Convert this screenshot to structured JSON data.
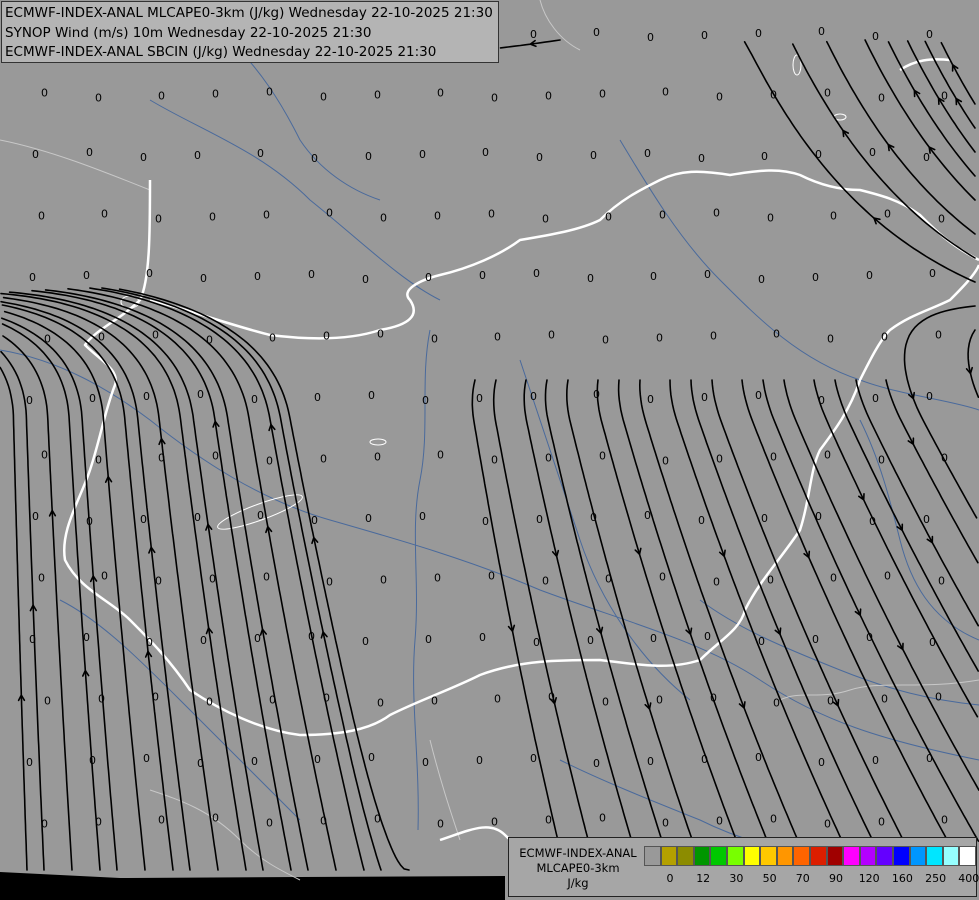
{
  "header": {
    "lines": [
      "ECMWF-INDEX-ANAL MLCAPE0-3km (J/kg) Wednesday 22-10-2025 21:30",
      "SYNOP Wind (m/s) 10m Wednesday 22-10-2025 21:30",
      "ECMWF-INDEX-ANAL SBCIN (J/kg) Wednesday 22-10-2025 21:30"
    ]
  },
  "legend": {
    "title_lines": [
      "ECMWF-INDEX-ANAL",
      "MLCAPE0-3km",
      "J/kg"
    ],
    "colors": [
      "#999999",
      "#b4a000",
      "#8c8c00",
      "#009600",
      "#00c800",
      "#78ff00",
      "#ffff00",
      "#ffc800",
      "#ff9600",
      "#ff6400",
      "#dc1e00",
      "#a00000",
      "#ff00ff",
      "#b400ff",
      "#6400ff",
      "#0000ff",
      "#0096ff",
      "#00e6ff",
      "#96ffff",
      "#ffffff"
    ],
    "tick_labels": [
      "0",
      "12",
      "30",
      "50",
      "70",
      "90",
      "120",
      "160",
      "250",
      "400"
    ]
  },
  "map": {
    "cin_value": "0",
    "background_color": "#999999",
    "border_color": "#ffffff",
    "river_color": "#4a6a9c",
    "streamline_color": "#000000"
  }
}
